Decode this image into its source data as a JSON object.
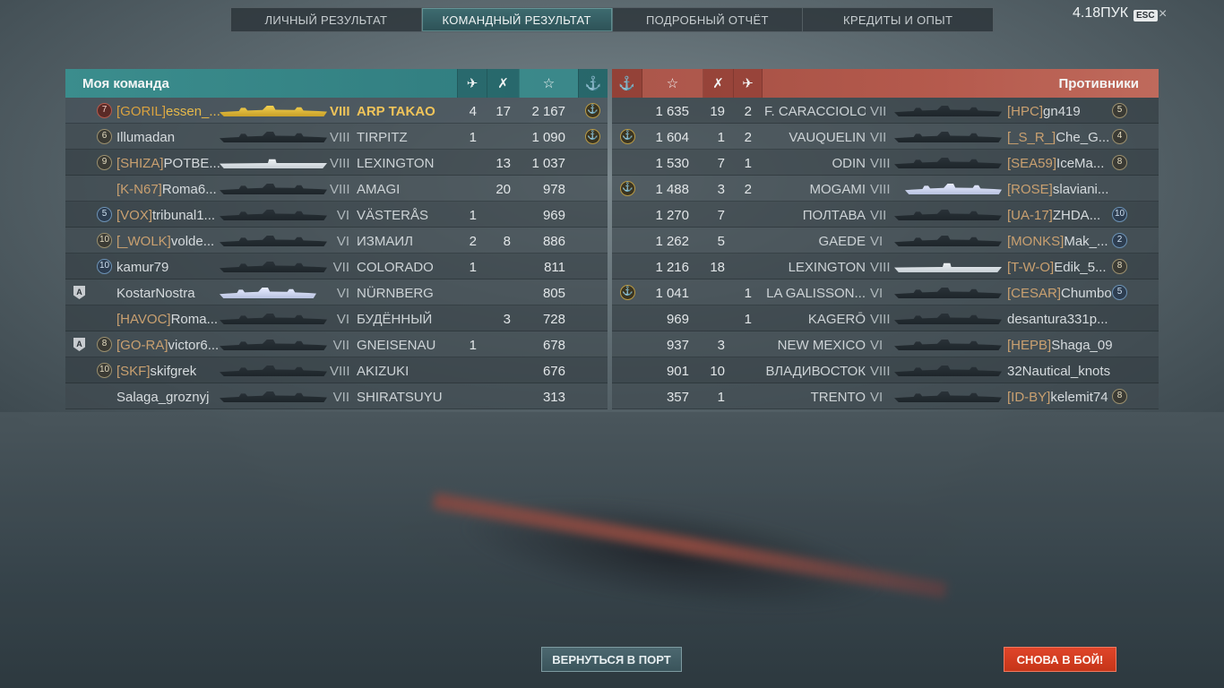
{
  "tabs": [
    {
      "label": "ЛИЧНЫЙ РЕЗУЛЬТАТ",
      "active": false
    },
    {
      "label": "КОМАНДНЫЙ РЕЗУЛЬТАТ",
      "active": true
    },
    {
      "label": "ПОДРОБНЫЙ ОТЧЁТ",
      "active": false
    },
    {
      "label": "КРЕДИТЫ И ОПЫТ",
      "active": false
    }
  ],
  "header": {
    "points": "4.18ПУК",
    "esc": "ESC",
    "close": "×"
  },
  "my_team": {
    "title": "Моя команда",
    "header_icons": {
      "planes": "plane-icon",
      "kills": "swords-icon",
      "xp": "star-icon",
      "ribbon": "anchor-medal-icon"
    },
    "header_glyphs": {
      "planes": "✈",
      "kills": "✗",
      "xp": "☆",
      "ribbon": "⚓"
    },
    "rows": [
      {
        "rank": "7",
        "rank_color": "red",
        "fleet": "",
        "clan": "[GORIL]",
        "name": "essen_...",
        "silhouette": "gold",
        "tier": "VIII",
        "ship": "ARP TAKAO",
        "planes": "4",
        "kills": "17",
        "xp": "2 167",
        "ribbon": "⚓",
        "me": true
      },
      {
        "rank": "6",
        "rank_color": "gold",
        "fleet": "",
        "clan": "",
        "name": "Illumadan",
        "silhouette": "dark",
        "tier": "VIII",
        "ship": "TIRPITZ",
        "planes": "1",
        "kills": "",
        "xp": "1 090",
        "ribbon": "⚓"
      },
      {
        "rank": "9",
        "rank_color": "gold",
        "fleet": "",
        "clan": "[SHIZA]",
        "name": "POTBE...",
        "silhouette": "white-carrier",
        "tier": "VIII",
        "ship": "LEXINGTON",
        "planes": "",
        "kills": "13",
        "xp": "1 037",
        "ribbon": ""
      },
      {
        "rank": "",
        "rank_color": "",
        "fleet": "",
        "clan": "[K-N67]",
        "name": "Roma6...",
        "silhouette": "dark",
        "tier": "VIII",
        "ship": "AMAGI",
        "planes": "",
        "kills": "20",
        "xp": "978",
        "ribbon": ""
      },
      {
        "rank": "5",
        "rank_color": "blue",
        "fleet": "",
        "clan": "[VOX]",
        "name": "tribunal1...",
        "silhouette": "dark",
        "tier": "VI",
        "ship": "VÄSTERÅS",
        "planes": "1",
        "kills": "",
        "xp": "969",
        "ribbon": ""
      },
      {
        "rank": "10",
        "rank_color": "gold",
        "fleet": "",
        "clan": "[_WOLK]",
        "name": "volde...",
        "silhouette": "dark",
        "tier": "VI",
        "ship": "ИЗМАИЛ",
        "planes": "2",
        "kills": "8",
        "xp": "886",
        "ribbon": ""
      },
      {
        "rank": "10",
        "rank_color": "blue",
        "fleet": "",
        "clan": "",
        "name": "kamur79",
        "silhouette": "dark",
        "tier": "VII",
        "ship": "COLORADO",
        "planes": "1",
        "kills": "",
        "xp": "811",
        "ribbon": ""
      },
      {
        "rank": "",
        "rank_color": "",
        "fleet": "A",
        "clan": "",
        "name": "KostarNostra",
        "silhouette": "light",
        "tier": "VI",
        "ship": "NÜRNBERG",
        "planes": "",
        "kills": "",
        "xp": "805",
        "ribbon": ""
      },
      {
        "rank": "",
        "rank_color": "",
        "fleet": "",
        "clan": "[HAVOC]",
        "name": "Roma...",
        "silhouette": "dark",
        "tier": "VI",
        "ship": "БУДЁННЫЙ",
        "planes": "",
        "kills": "3",
        "xp": "728",
        "ribbon": ""
      },
      {
        "rank": "8",
        "rank_color": "gold",
        "fleet": "A",
        "clan": "[GO-RA]",
        "name": "victor6...",
        "silhouette": "dark",
        "tier": "VII",
        "ship": "GNEISENAU",
        "planes": "1",
        "kills": "",
        "xp": "678",
        "ribbon": ""
      },
      {
        "rank": "10",
        "rank_color": "gold",
        "fleet": "",
        "clan": "[SKF]",
        "name": "skifgrek",
        "silhouette": "dark",
        "tier": "VIII",
        "ship": "AKIZUKI",
        "planes": "",
        "kills": "",
        "xp": "676",
        "ribbon": ""
      },
      {
        "rank": "",
        "rank_color": "",
        "fleet": "",
        "clan": "",
        "name": "Salaga_groznyj",
        "silhouette": "dark",
        "tier": "VII",
        "ship": "SHIRATSUYU",
        "planes": "",
        "kills": "",
        "xp": "313",
        "ribbon": ""
      }
    ]
  },
  "enemy_team": {
    "title": "Противники",
    "header_icons": {
      "ribbon": "anchor-medal-icon",
      "xp": "star-icon",
      "kills": "swords-icon",
      "planes": "plane-icon"
    },
    "header_glyphs": {
      "ribbon": "⚓",
      "xp": "☆",
      "kills": "✗",
      "planes": "✈"
    },
    "rows": [
      {
        "ribbon": "",
        "xp": "1 635",
        "kills": "19",
        "planes": "2",
        "ship": "F. CARACCIOLO",
        "tier": "VII",
        "silhouette": "dark",
        "clan": "[HPC]",
        "name": "gn419",
        "rank": "5",
        "rank_color": "gold"
      },
      {
        "ribbon": "⚓",
        "xp": "1 604",
        "kills": "1",
        "planes": "2",
        "ship": "VAUQUELIN",
        "tier": "VII",
        "silhouette": "dark",
        "clan": "[_S_R_]",
        "name": "Che_G...",
        "rank": "4",
        "rank_color": "gold"
      },
      {
        "ribbon": "",
        "xp": "1 530",
        "kills": "7",
        "planes": "1",
        "ship": "ODIN",
        "tier": "VIII",
        "silhouette": "dark",
        "clan": "[SEA59]",
        "name": "IceMa...",
        "rank": "8",
        "rank_color": "gold"
      },
      {
        "ribbon": "⚓",
        "xp": "1 488",
        "kills": "3",
        "planes": "2",
        "ship": "MOGAMI",
        "tier": "VIII",
        "silhouette": "light",
        "clan": "[ROSE]",
        "name": "slaviani...",
        "rank": "",
        "rank_color": ""
      },
      {
        "ribbon": "",
        "xp": "1 270",
        "kills": "7",
        "planes": "",
        "ship": "ПОЛТАВА",
        "tier": "VII",
        "silhouette": "dark",
        "clan": "[UA-17]",
        "name": "ZHDA...",
        "rank": "10",
        "rank_color": "blue"
      },
      {
        "ribbon": "",
        "xp": "1 262",
        "kills": "5",
        "planes": "",
        "ship": "GAEDE",
        "tier": "VI",
        "silhouette": "dark",
        "clan": "[MONKS]",
        "name": "Mak_...",
        "rank": "2",
        "rank_color": "blue"
      },
      {
        "ribbon": "",
        "xp": "1 216",
        "kills": "18",
        "planes": "",
        "ship": "LEXINGTON",
        "tier": "VIII",
        "silhouette": "white-carrier",
        "clan": "[T-W-O]",
        "name": "Edik_5...",
        "rank": "8",
        "rank_color": "gold"
      },
      {
        "ribbon": "⚓",
        "xp": "1 041",
        "kills": "",
        "planes": "1",
        "ship": "LA GALISSON...",
        "tier": "VI",
        "silhouette": "dark",
        "clan": "[CESAR]",
        "name": "Chumbo",
        "rank": "5",
        "rank_color": "blue"
      },
      {
        "ribbon": "",
        "xp": "969",
        "kills": "",
        "planes": "1",
        "ship": "KAGERŌ",
        "tier": "VIII",
        "silhouette": "dark",
        "clan": "",
        "name": "desantura331p...",
        "rank": "",
        "rank_color": ""
      },
      {
        "ribbon": "",
        "xp": "937",
        "kills": "3",
        "planes": "",
        "ship": "NEW MEXICO",
        "tier": "VI",
        "silhouette": "dark",
        "clan": "[HEPB]",
        "name": "Shaga_09",
        "rank": "",
        "rank_color": ""
      },
      {
        "ribbon": "",
        "xp": "901",
        "kills": "10",
        "planes": "",
        "ship": "ВЛАДИВОСТОК",
        "tier": "VIII",
        "silhouette": "dark",
        "clan": "",
        "name": "32Nautical_knots",
        "rank": "",
        "rank_color": ""
      },
      {
        "ribbon": "",
        "xp": "357",
        "kills": "1",
        "planes": "",
        "ship": "TRENTO",
        "tier": "VI",
        "silhouette": "dark",
        "clan": "[ID-BY]",
        "name": "kelemit74",
        "rank": "8",
        "rank_color": "gold"
      }
    ]
  },
  "buttons": {
    "port": "ВЕРНУТЬСЯ В ПОРТ",
    "battle": "СНОВА В БОЙ!"
  },
  "colors": {
    "ally_header": "#3b8d8d",
    "enemy_header": "#b55a4d",
    "clan_tag": "#c9a070",
    "me_highlight": "#f0c45a",
    "battle_button": "#d63e22"
  }
}
